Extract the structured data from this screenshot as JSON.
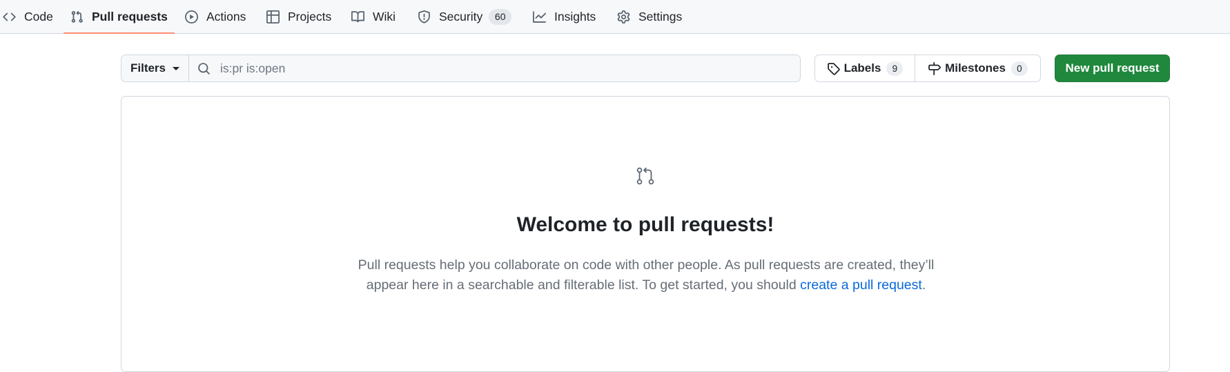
{
  "repo_nav": {
    "items": [
      {
        "label": "Code",
        "icon": "code-icon"
      },
      {
        "label": "Pull requests",
        "icon": "git-pull-request-icon",
        "selected": true
      },
      {
        "label": "Actions",
        "icon": "play-icon"
      },
      {
        "label": "Projects",
        "icon": "table-icon"
      },
      {
        "label": "Wiki",
        "icon": "book-icon"
      },
      {
        "label": "Security",
        "icon": "shield-icon",
        "counter": "60"
      },
      {
        "label": "Insights",
        "icon": "graph-icon"
      },
      {
        "label": "Settings",
        "icon": "gear-icon"
      }
    ],
    "accent_color": "#fd8c73"
  },
  "subnav": {
    "filters_label": "Filters",
    "search": {
      "value": "",
      "placeholder": "is:pr is:open",
      "icon": "search-icon"
    },
    "labels": {
      "label": "Labels",
      "count": "9",
      "icon": "tag-icon"
    },
    "milestones": {
      "label": "Milestones",
      "count": "0",
      "icon": "milestone-icon"
    },
    "new_pr_label": "New pull request",
    "new_pr_color": "#1f883d"
  },
  "blankslate": {
    "icon": "git-pull-request-icon",
    "title": "Welcome to pull requests!",
    "desc_line1": "Pull requests help you collaborate on code with other people. As pull requests are created, they’ll",
    "desc_line2_prefix": "appear here in a searchable and filterable list. To get started, you should ",
    "link_text": "create a pull request",
    "desc_suffix": ".",
    "link_color": "#0969da"
  }
}
